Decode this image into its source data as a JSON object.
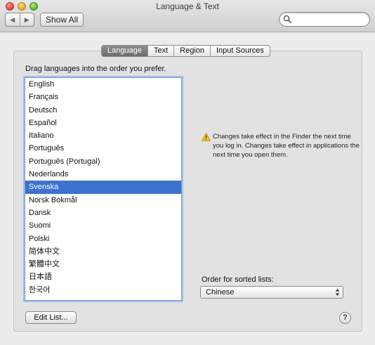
{
  "window": {
    "title": "Language & Text"
  },
  "toolbar": {
    "back_glyph": "◀",
    "forward_glyph": "▶",
    "show_all_label": "Show All",
    "search_placeholder": ""
  },
  "tabs": [
    {
      "label": "Language",
      "active": true
    },
    {
      "label": "Text",
      "active": false
    },
    {
      "label": "Region",
      "active": false
    },
    {
      "label": "Input Sources",
      "active": false
    }
  ],
  "language_pane": {
    "instruction": "Drag languages into the order you prefer.",
    "languages": [
      "English",
      "Français",
      "Deutsch",
      "Español",
      "Italiano",
      "Português",
      "Português (Portugal)",
      "Nederlands",
      "Svenska",
      "Norsk Bokmål",
      "Dansk",
      "Suomi",
      "Polski",
      "简体中文",
      "繁體中文",
      "日本語",
      "한국어"
    ],
    "selected_language": "Svenska",
    "notice_icon": "warning-icon",
    "notice": "Changes take effect in the Finder the next time you log in. Changes take effect in applications the next time you open them.",
    "sort_label": "Order for sorted lists:",
    "sort_value": "Chinese",
    "edit_button_label": "Edit List...",
    "help_label": "?"
  },
  "colors": {
    "selection": "#3d72cf",
    "list_focus_ring": "#9ec0ee",
    "active_tab": "#7a7a7a",
    "warning": "#f3c319"
  }
}
